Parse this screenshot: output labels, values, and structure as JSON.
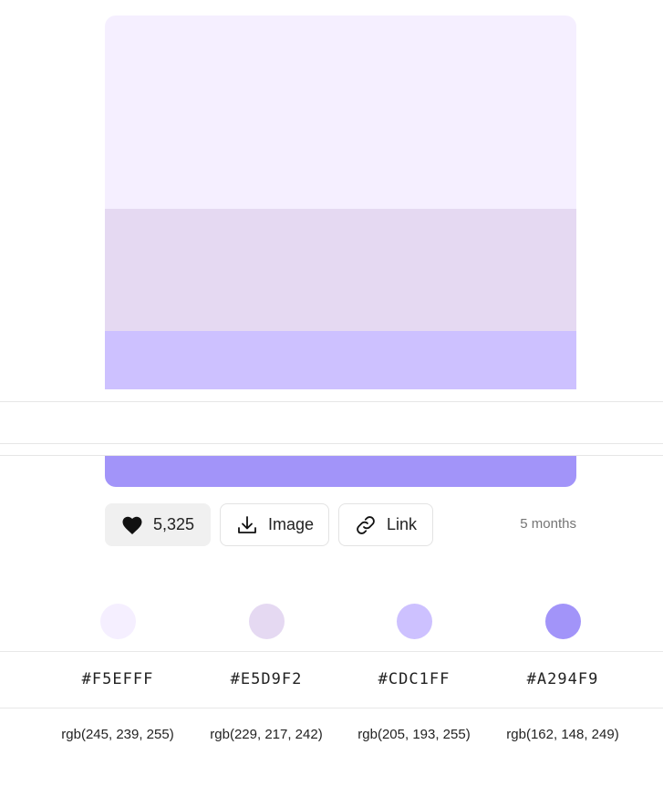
{
  "palette": {
    "colors": [
      "#F5EFFF",
      "#E5D9F2",
      "#CDC1FF",
      "#A294F9"
    ]
  },
  "actions": {
    "likes": "5,325",
    "image_label": "Image",
    "link_label": "Link"
  },
  "timestamp": "5 months",
  "swatches": [
    {
      "hex": "#F5EFFF",
      "rgb": "rgb(245, 239, 255)"
    },
    {
      "hex": "#E5D9F2",
      "rgb": "rgb(229, 217, 242)"
    },
    {
      "hex": "#CDC1FF",
      "rgb": "rgb(205, 193, 255)"
    },
    {
      "hex": "#A294F9",
      "rgb": "rgb(162, 148, 249)"
    }
  ]
}
